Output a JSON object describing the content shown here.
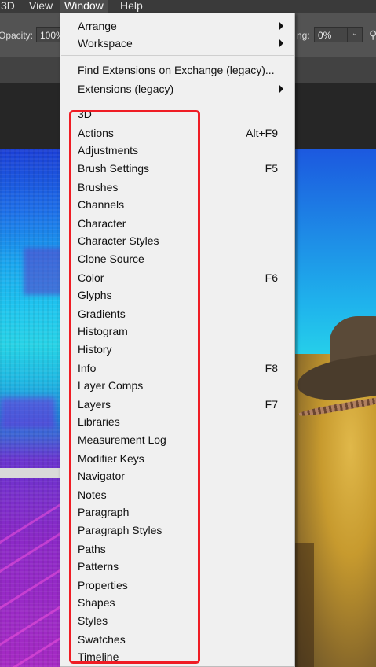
{
  "menubar": {
    "items": [
      {
        "label": "3D"
      },
      {
        "label": "View"
      },
      {
        "label": "Window"
      },
      {
        "label": "Help"
      }
    ]
  },
  "options_bar": {
    "opacity_label": "Opacity:",
    "opacity_value": "100%",
    "right_label": "ng:",
    "right_value": "0%"
  },
  "window_menu": {
    "arrange": "Arrange",
    "workspace": "Workspace",
    "find_extensions": "Find Extensions on Exchange (legacy)...",
    "extensions": "Extensions (legacy)",
    "panels": [
      {
        "label": "3D",
        "shortcut": ""
      },
      {
        "label": "Actions",
        "shortcut": "Alt+F9"
      },
      {
        "label": "Adjustments",
        "shortcut": ""
      },
      {
        "label": "Brush Settings",
        "shortcut": "F5"
      },
      {
        "label": "Brushes",
        "shortcut": ""
      },
      {
        "label": "Channels",
        "shortcut": ""
      },
      {
        "label": "Character",
        "shortcut": ""
      },
      {
        "label": "Character Styles",
        "shortcut": ""
      },
      {
        "label": "Clone Source",
        "shortcut": ""
      },
      {
        "label": "Color",
        "shortcut": "F6"
      },
      {
        "label": "Glyphs",
        "shortcut": ""
      },
      {
        "label": "Gradients",
        "shortcut": ""
      },
      {
        "label": "Histogram",
        "shortcut": ""
      },
      {
        "label": "History",
        "shortcut": ""
      },
      {
        "label": "Info",
        "shortcut": "F8"
      },
      {
        "label": "Layer Comps",
        "shortcut": ""
      },
      {
        "label": "Layers",
        "shortcut": "F7"
      },
      {
        "label": "Libraries",
        "shortcut": ""
      },
      {
        "label": "Measurement Log",
        "shortcut": ""
      },
      {
        "label": "Modifier Keys",
        "shortcut": ""
      },
      {
        "label": "Navigator",
        "shortcut": ""
      },
      {
        "label": "Notes",
        "shortcut": ""
      },
      {
        "label": "Paragraph",
        "shortcut": ""
      },
      {
        "label": "Paragraph Styles",
        "shortcut": ""
      },
      {
        "label": "Paths",
        "shortcut": ""
      },
      {
        "label": "Patterns",
        "shortcut": ""
      },
      {
        "label": "Properties",
        "shortcut": ""
      },
      {
        "label": "Shapes",
        "shortcut": ""
      },
      {
        "label": "Styles",
        "shortcut": ""
      },
      {
        "label": "Swatches",
        "shortcut": ""
      },
      {
        "label": "Timeline",
        "shortcut": ""
      }
    ]
  },
  "colors": {
    "highlight_outline": "#ef1c24",
    "menu_background": "#f0f0f0",
    "app_chrome": "#535353"
  }
}
